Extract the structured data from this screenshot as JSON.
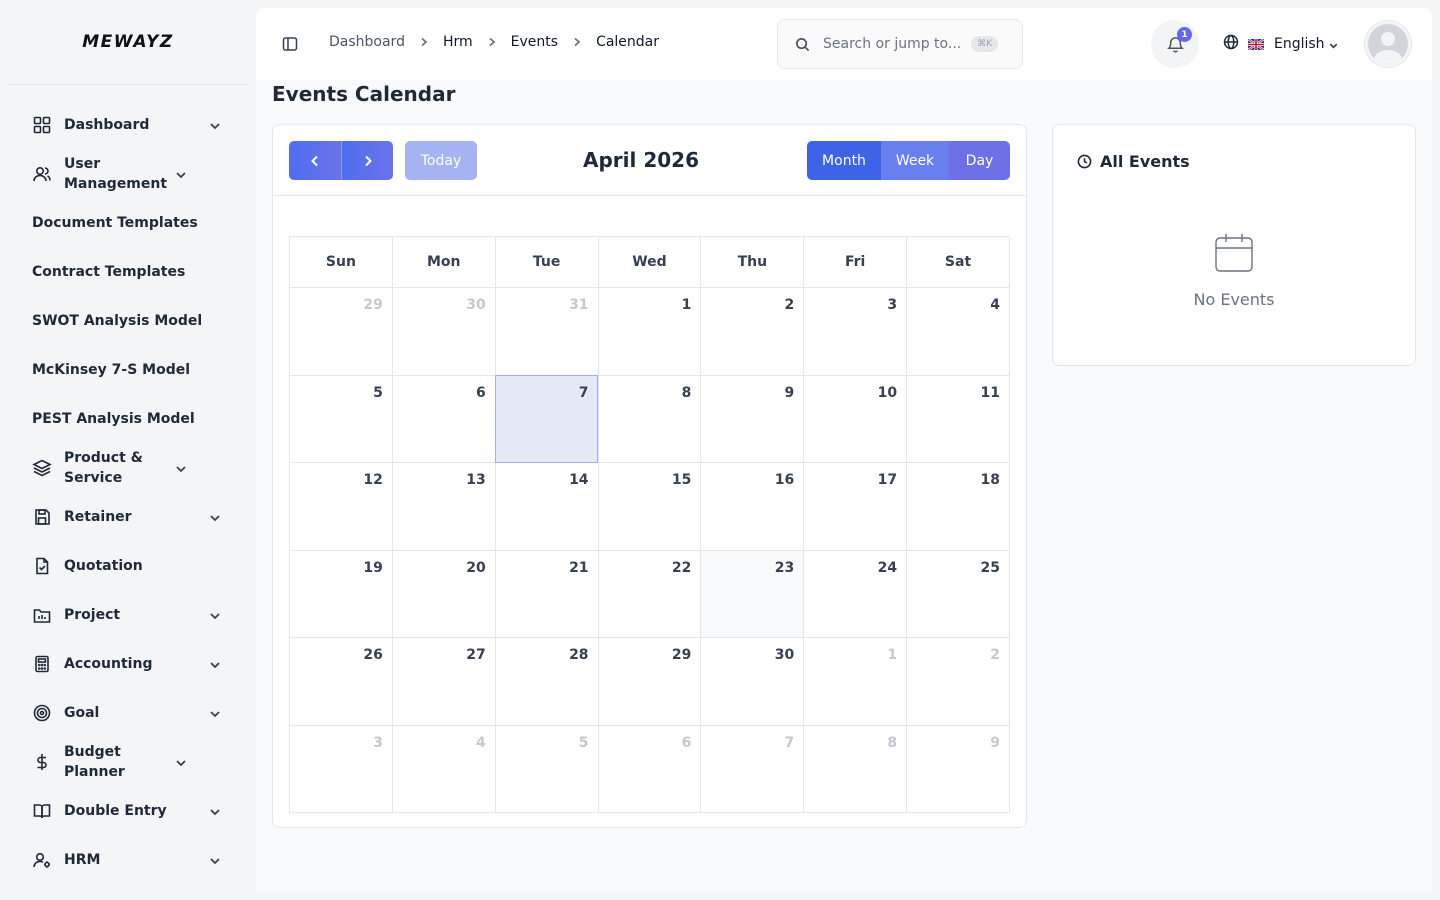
{
  "brand": {
    "logo_text": "MEWAYZ"
  },
  "sidebar": {
    "items": [
      {
        "label": "Dashboard",
        "icon": "dashboard-grid-icon",
        "has_chevron": true
      },
      {
        "label": "User Management",
        "icon": "users-icon",
        "has_chevron": true
      },
      {
        "label": "Document Templates",
        "icon": "",
        "has_chevron": false
      },
      {
        "label": "Contract Templates",
        "icon": "",
        "has_chevron": false
      },
      {
        "label": "SWOT Analysis Model",
        "icon": "",
        "has_chevron": false
      },
      {
        "label": "McKinsey 7-S Model",
        "icon": "",
        "has_chevron": false
      },
      {
        "label": "PEST Analysis Model",
        "icon": "",
        "has_chevron": false
      },
      {
        "label": "Product & Service",
        "icon": "layers-icon",
        "has_chevron": true
      },
      {
        "label": "Retainer",
        "icon": "save-icon",
        "has_chevron": true
      },
      {
        "label": "Quotation",
        "icon": "file-check-icon",
        "has_chevron": false
      },
      {
        "label": "Project",
        "icon": "folder-chart-icon",
        "has_chevron": true
      },
      {
        "label": "Accounting",
        "icon": "calculator-icon",
        "has_chevron": true
      },
      {
        "label": "Goal",
        "icon": "target-icon",
        "has_chevron": true
      },
      {
        "label": "Budget Planner",
        "icon": "dollar-icon",
        "has_chevron": true
      },
      {
        "label": "Double Entry",
        "icon": "book-icon",
        "has_chevron": true
      },
      {
        "label": "HRM",
        "icon": "user-cog-icon",
        "has_chevron": true
      }
    ]
  },
  "header": {
    "breadcrumbs": [
      "Dashboard",
      "Hrm",
      "Events",
      "Calendar"
    ],
    "search": {
      "placeholder": "Search or jump to...",
      "shortcut": "⌘K"
    },
    "notifications": {
      "count": "1"
    },
    "language": {
      "label": "English"
    }
  },
  "page": {
    "title": "Events Calendar"
  },
  "calendar": {
    "month_label": "April 2026",
    "today_button": "Today",
    "views": [
      "Month",
      "Week",
      "Day"
    ],
    "active_view": "Month",
    "weekdays": [
      "Sun",
      "Mon",
      "Tue",
      "Wed",
      "Thu",
      "Fri",
      "Sat"
    ],
    "weeks": [
      [
        {
          "d": "29",
          "o": true
        },
        {
          "d": "30",
          "o": true
        },
        {
          "d": "31",
          "o": true
        },
        {
          "d": "1"
        },
        {
          "d": "2"
        },
        {
          "d": "3"
        },
        {
          "d": "4"
        }
      ],
      [
        {
          "d": "5"
        },
        {
          "d": "6"
        },
        {
          "d": "7",
          "today": true
        },
        {
          "d": "8"
        },
        {
          "d": "9"
        },
        {
          "d": "10"
        },
        {
          "d": "11"
        }
      ],
      [
        {
          "d": "12"
        },
        {
          "d": "13"
        },
        {
          "d": "14"
        },
        {
          "d": "15"
        },
        {
          "d": "16"
        },
        {
          "d": "17"
        },
        {
          "d": "18"
        }
      ],
      [
        {
          "d": "19"
        },
        {
          "d": "20"
        },
        {
          "d": "21"
        },
        {
          "d": "22"
        },
        {
          "d": "23",
          "hover": true
        },
        {
          "d": "24"
        },
        {
          "d": "25"
        }
      ],
      [
        {
          "d": "26"
        },
        {
          "d": "27"
        },
        {
          "d": "28"
        },
        {
          "d": "29"
        },
        {
          "d": "30"
        },
        {
          "d": "1",
          "o": true
        },
        {
          "d": "2",
          "o": true
        }
      ],
      [
        {
          "d": "3",
          "o": true
        },
        {
          "d": "4",
          "o": true
        },
        {
          "d": "5",
          "o": true
        },
        {
          "d": "6",
          "o": true
        },
        {
          "d": "7",
          "o": true
        },
        {
          "d": "8",
          "o": true
        },
        {
          "d": "9",
          "o": true
        }
      ]
    ]
  },
  "events_panel": {
    "title": "All Events",
    "empty_text": "No Events"
  },
  "colors": {
    "primary": "#4f6ef0",
    "today_bg": "#e4e9f4",
    "badge": "#6366f1"
  }
}
